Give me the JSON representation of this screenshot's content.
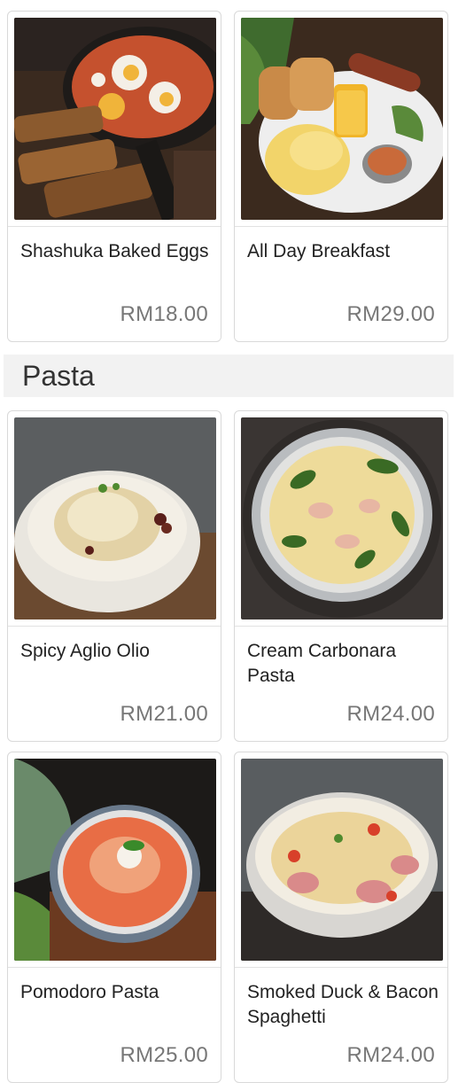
{
  "breakfast_items": [
    {
      "name": "Shashuka Baked Eggs",
      "price": "RM18.00",
      "image_icon": "shakshuka-photo"
    },
    {
      "name": "All Day Breakfast",
      "price": "RM29.00",
      "image_icon": "breakfast-plate-photo"
    }
  ],
  "section": {
    "title": "Pasta"
  },
  "pasta_items": [
    {
      "name": "Spicy Aglio Olio",
      "price": "RM21.00",
      "image_icon": "aglio-olio-photo"
    },
    {
      "name": "Cream Carbonara Pasta",
      "price": "RM24.00",
      "image_icon": "carbonara-photo"
    },
    {
      "name": "Pomodoro Pasta",
      "price": "RM25.00",
      "image_icon": "pomodoro-photo"
    },
    {
      "name": "Smoked Duck & Bacon Spaghetti",
      "price": "RM24.00",
      "image_icon": "duck-spaghetti-photo"
    }
  ],
  "colors": {
    "price": "#777777",
    "border": "#d9d9d9",
    "section_bg": "#f2f2f2"
  }
}
